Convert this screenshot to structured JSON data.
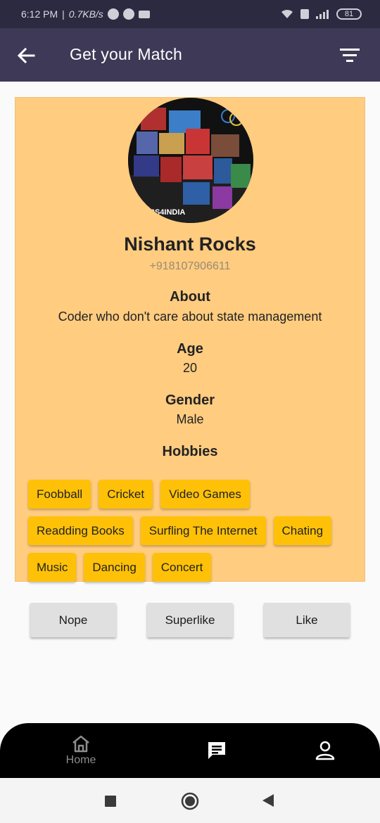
{
  "status_bar": {
    "time": "6:12 PM",
    "speed": "0.7KB/s",
    "battery": "81"
  },
  "app_bar": {
    "title": "Get your Match",
    "back_icon": "arrow-left-icon",
    "filter_icon": "filter-icon"
  },
  "profile": {
    "name": "Nishant Rocks",
    "phone": "+918107906611",
    "avatar_text": "RS4INDIA",
    "about_title": "About",
    "about_value": "Coder who don't care about state management",
    "age_title": "Age",
    "age_value": "20",
    "gender_title": "Gender",
    "gender_value": "Male",
    "hobbies_title": "Hobbies",
    "hobbies": [
      "Foobball",
      "Cricket",
      "Video Games",
      "Readding Books",
      "Surfling The Internet",
      "Chating",
      "Music",
      "Dancing",
      "Concert"
    ]
  },
  "actions": {
    "nope": "Nope",
    "superlike": "Superlike",
    "like": "Like"
  },
  "bottom_nav": {
    "home_label": "Home"
  },
  "colors": {
    "app_bar": "#3e3956",
    "card": "#ffcc80",
    "chip": "#ffc107"
  }
}
